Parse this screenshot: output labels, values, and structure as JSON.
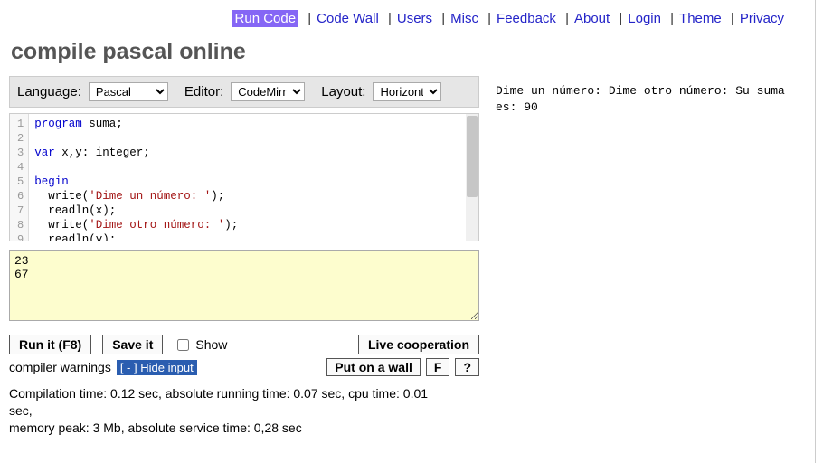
{
  "nav": {
    "items": [
      {
        "label": "Run Code",
        "active": true
      },
      {
        "label": "Code Wall"
      },
      {
        "label": "Users"
      },
      {
        "label": "Misc"
      },
      {
        "label": "Feedback"
      },
      {
        "label": "About"
      },
      {
        "label": "Login"
      },
      {
        "label": "Theme"
      },
      {
        "label": "Privacy"
      }
    ]
  },
  "title": "compile pascal online",
  "config": {
    "language_label": "Language:",
    "language_value": "Pascal",
    "editor_label": "Editor:",
    "editor_value": "CodeMirror",
    "layout_label": "Layout:",
    "layout_value": "Horizontal"
  },
  "code": {
    "lines": [
      {
        "n": 1,
        "tokens": [
          {
            "t": "program",
            "c": "kw"
          },
          {
            "t": " suma;"
          }
        ]
      },
      {
        "n": 2,
        "tokens": []
      },
      {
        "n": 3,
        "tokens": [
          {
            "t": "var",
            "c": "kw"
          },
          {
            "t": " x,y: integer;"
          }
        ]
      },
      {
        "n": 4,
        "tokens": []
      },
      {
        "n": 5,
        "tokens": [
          {
            "t": "begin",
            "c": "kw"
          }
        ]
      },
      {
        "n": 6,
        "tokens": [
          {
            "t": "  write("
          },
          {
            "t": "'Dime un número: '",
            "c": "str"
          },
          {
            "t": ");"
          }
        ]
      },
      {
        "n": 7,
        "tokens": [
          {
            "t": "  readln(x);"
          }
        ]
      },
      {
        "n": 8,
        "tokens": [
          {
            "t": "  write("
          },
          {
            "t": "'Dime otro número: '",
            "c": "str"
          },
          {
            "t": ");"
          }
        ]
      },
      {
        "n": 9,
        "tokens": [
          {
            "t": "  readln(y);"
          }
        ]
      }
    ]
  },
  "stdin": "23\n67",
  "buttons": {
    "run": "Run it (F8)",
    "save": "Save it",
    "show": "Show",
    "coop": "Live cooperation",
    "warnings": "compiler warnings",
    "hide_input": "[ - ] Hide input",
    "put_wall": "Put on a wall",
    "f": "F",
    "q": "?"
  },
  "stats_line1": "Compilation time: 0.12 sec, absolute running time: 0.07 sec, cpu time: 0.01 sec,",
  "stats_line2": "memory peak: 3 Mb, absolute service time: 0,28 sec",
  "output": "Dime un número: Dime otro número: Su suma es: 90"
}
